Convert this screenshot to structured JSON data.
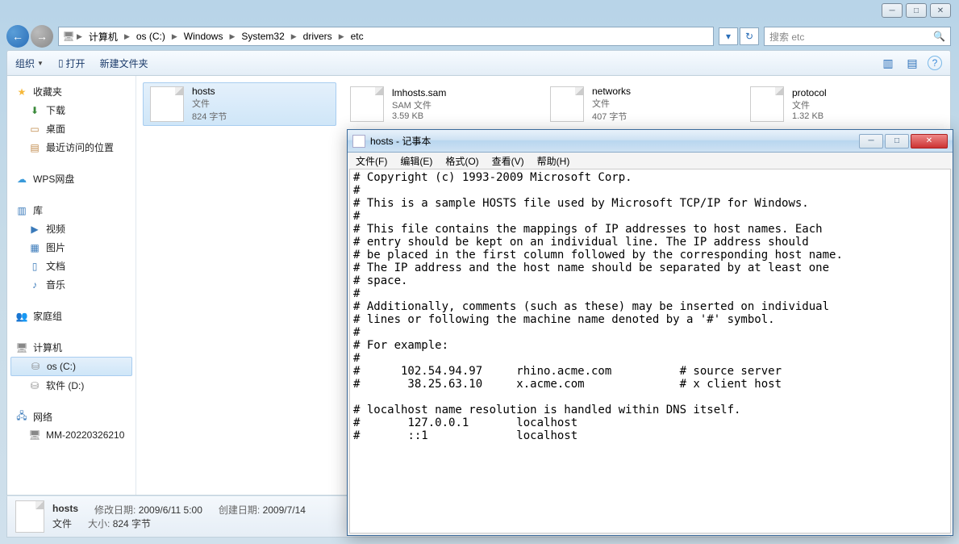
{
  "win_controls": {
    "min": "─",
    "max": "□",
    "close": "✕"
  },
  "nav": {
    "back": "←",
    "fwd": "→",
    "breadcrumb": [
      "计算机",
      "os (C:)",
      "Windows",
      "System32",
      "drivers",
      "etc"
    ],
    "refresh": "↻",
    "search_placeholder": "搜索 etc",
    "search_icon": "🔍"
  },
  "toolbar": {
    "organize": "组织",
    "open": "打开",
    "new_folder": "新建文件夹",
    "view_icon": "▥",
    "panel_icon": "▤",
    "help_icon": "?"
  },
  "sidebar": {
    "favorites": {
      "label": "收藏夹",
      "items": [
        "下载",
        "桌面",
        "最近访问的位置"
      ]
    },
    "wps": "WPS网盘",
    "library": {
      "label": "库",
      "items": [
        "视频",
        "图片",
        "文档",
        "音乐"
      ]
    },
    "homegroup": "家庭组",
    "computer": {
      "label": "计算机",
      "items": [
        "os (C:)",
        "软件 (D:)"
      ]
    },
    "network": {
      "label": "网络",
      "items": [
        "MM-20220326210"
      ]
    }
  },
  "files": [
    {
      "name": "hosts",
      "type": "文件",
      "size": "824 字节",
      "selected": true
    },
    {
      "name": "lmhosts.sam",
      "type": "SAM 文件",
      "size": "3.59 KB"
    },
    {
      "name": "networks",
      "type": "文件",
      "size": "407 字节"
    },
    {
      "name": "protocol",
      "type": "文件",
      "size": "1.32 KB"
    }
  ],
  "details": {
    "name": "hosts",
    "type": "文件",
    "modified_label": "修改日期:",
    "modified": "2009/6/11 5:00",
    "created_label": "创建日期:",
    "created": "2009/7/14",
    "size_label": "大小:",
    "size": "824 字节"
  },
  "notepad": {
    "title": "hosts - 记事本",
    "menu": [
      "文件(F)",
      "编辑(E)",
      "格式(O)",
      "查看(V)",
      "帮助(H)"
    ],
    "body": "# Copyright (c) 1993-2009 Microsoft Corp.\n#\n# This is a sample HOSTS file used by Microsoft TCP/IP for Windows.\n#\n# This file contains the mappings of IP addresses to host names. Each\n# entry should be kept on an individual line. The IP address should\n# be placed in the first column followed by the corresponding host name.\n# The IP address and the host name should be separated by at least one\n# space.\n#\n# Additionally, comments (such as these) may be inserted on individual\n# lines or following the machine name denoted by a '#' symbol.\n#\n# For example:\n#\n#      102.54.94.97     rhino.acme.com          # source server\n#       38.25.63.10     x.acme.com              # x client host\n\n# localhost name resolution is handled within DNS itself.\n#\t127.0.0.1       localhost\n#\t::1             localhost"
  }
}
